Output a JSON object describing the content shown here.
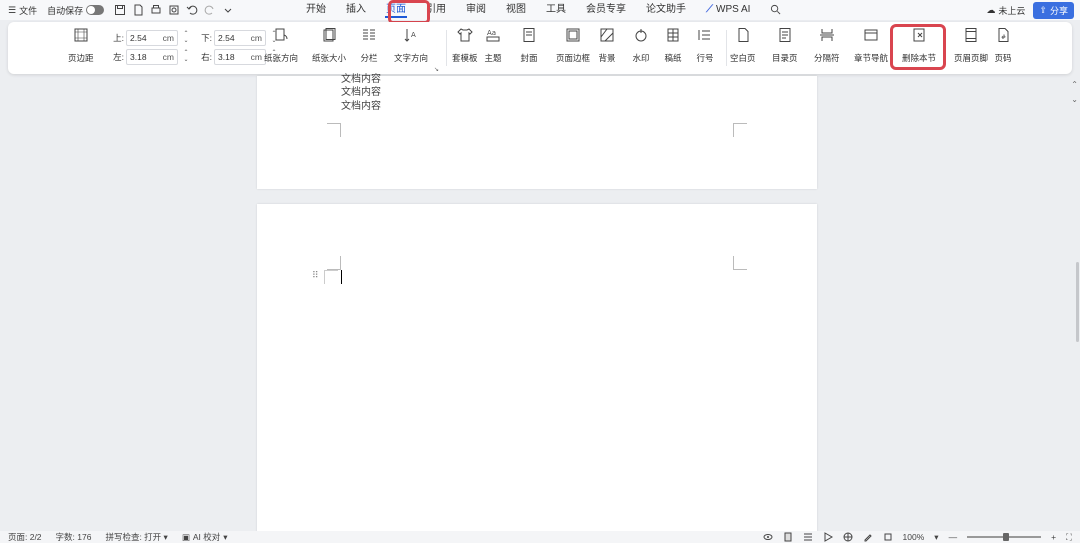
{
  "menubar": {
    "menu_label": "文件",
    "autosave_label": "自动保存",
    "tabs": [
      "开始",
      "插入",
      "页面",
      "引用",
      "审阅",
      "视图",
      "工具",
      "会员专享",
      "论文助手",
      "WPS AI"
    ],
    "active_tab": "页面",
    "cloud_label": "未上云",
    "share_label": "分享"
  },
  "ribbon": {
    "margin_label": "页边距",
    "margins": {
      "top_label": "上:",
      "top_value": "2.54",
      "top_unit": "cm",
      "bottom_label": "下:",
      "bottom_value": "2.54",
      "bottom_unit": "cm",
      "left_label": "左:",
      "left_value": "3.18",
      "left_unit": "cm",
      "right_label": "右:",
      "right_value": "3.18",
      "right_unit": "cm"
    },
    "buttons": [
      {
        "label": "纸张方向",
        "icon": "page-orientation-icon"
      },
      {
        "label": "纸张大小",
        "icon": "page-size-icon"
      },
      {
        "label": "分栏",
        "icon": "columns-icon"
      },
      {
        "label": "文字方向",
        "icon": "text-direction-icon"
      },
      {
        "label": "套模板",
        "icon": "template-icon"
      },
      {
        "label": "主题",
        "icon": "theme-icon"
      },
      {
        "label": "封面",
        "icon": "cover-icon"
      },
      {
        "label": "页面边框",
        "icon": "page-border-icon"
      },
      {
        "label": "背景",
        "icon": "background-icon"
      },
      {
        "label": "水印",
        "icon": "watermark-icon"
      },
      {
        "label": "稿纸",
        "icon": "manuscript-icon"
      },
      {
        "label": "行号",
        "icon": "line-number-icon"
      },
      {
        "label": "空白页",
        "icon": "blank-page-icon"
      },
      {
        "label": "目录页",
        "icon": "toc-page-icon"
      },
      {
        "label": "分隔符",
        "icon": "separator-icon"
      },
      {
        "label": "章节导航",
        "icon": "section-nav-icon"
      },
      {
        "label": "删除本节",
        "icon": "delete-section-icon"
      },
      {
        "label": "页眉页脚",
        "icon": "header-footer-icon"
      },
      {
        "label": "页码",
        "icon": "page-number-icon"
      }
    ]
  },
  "document": {
    "page1_lines": [
      "文档内容",
      "文档内容",
      "文档内容"
    ]
  },
  "status": {
    "page": "页面: 2/2",
    "words": "字数: 176",
    "spell": "拼写检查: 打开",
    "ai_check": "AI 校对",
    "zoom": "100%"
  },
  "colors": {
    "accent": "#1f5ad6",
    "highlight": "#d9454f",
    "share_bg": "#3a6fe0"
  }
}
